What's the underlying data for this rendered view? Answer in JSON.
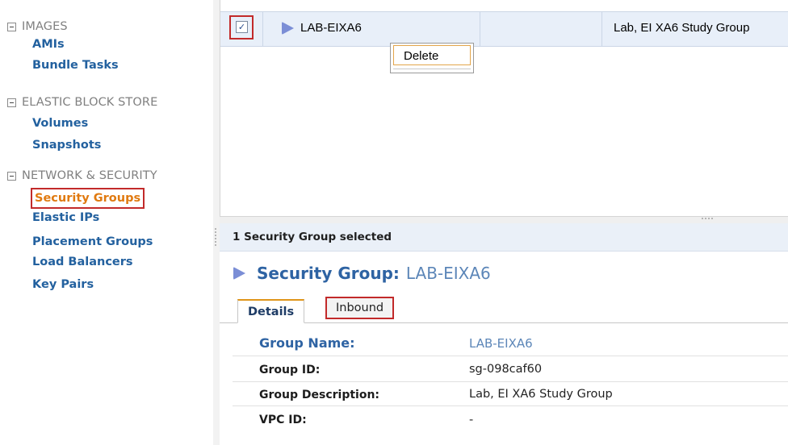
{
  "sidebar": {
    "sections": [
      {
        "title": "IMAGES",
        "items": [
          "AMIs",
          "Bundle Tasks"
        ]
      },
      {
        "title": "ELASTIC BLOCK STORE",
        "items": [
          "Volumes",
          "Snapshots"
        ]
      },
      {
        "title": "NETWORK & SECURITY",
        "items": [
          "Security Groups",
          "Elastic IPs",
          "Placement Groups",
          "Load Balancers",
          "Key Pairs"
        ]
      }
    ],
    "active_item": "Security Groups"
  },
  "grid": {
    "row": {
      "checked": true,
      "check_glyph": "✓",
      "name": "LAB-EIXA6",
      "description": "Lab, EI XA6 Study Group"
    }
  },
  "context_menu": {
    "items": [
      "Delete"
    ]
  },
  "detail": {
    "selection_text": "1 Security Group selected",
    "title_label": "Security Group:",
    "title_value": "LAB-EIXA6",
    "tabs": [
      "Details",
      "Inbound"
    ],
    "active_tab": "Details",
    "properties": [
      {
        "label": "Group Name:",
        "value": "LAB-EIXA6"
      },
      {
        "label": "Group ID:",
        "value": "sg-098caf60"
      },
      {
        "label": "Group Description:",
        "value": "Lab, EI XA6 Study Group"
      },
      {
        "label": "VPC ID:",
        "value": "-"
      }
    ]
  },
  "colors": {
    "link_blue": "#23619f",
    "active_orange": "#e07a10",
    "highlight_red": "#c22a2a",
    "row_selected": "#e8eff9"
  }
}
